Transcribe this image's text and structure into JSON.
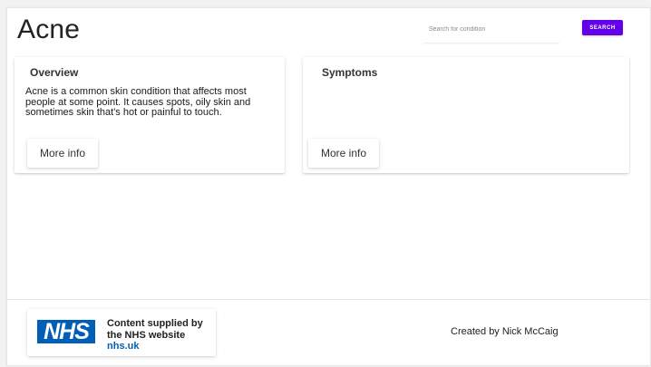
{
  "page": {
    "title": "Acne"
  },
  "search": {
    "placeholder": "Search for condition",
    "button_label": "SEARCH"
  },
  "cards": {
    "overview": {
      "title": "Overview",
      "text": "Acne is a common skin condition that affects most people at some point. It causes spots, oily skin and sometimes skin that's hot or painful to touch.",
      "button_label": "More info"
    },
    "symptoms": {
      "title": "Symptoms",
      "button_label": "More info"
    }
  },
  "footer": {
    "nhs_logo": "NHS",
    "nhs_line1": "Content supplied by",
    "nhs_line2": "the NHS website",
    "nhs_link": "nhs.uk",
    "credit": "Created by Nick McCaig"
  },
  "colors": {
    "accent": "#6200ea",
    "nhs_blue": "#005eb8"
  }
}
